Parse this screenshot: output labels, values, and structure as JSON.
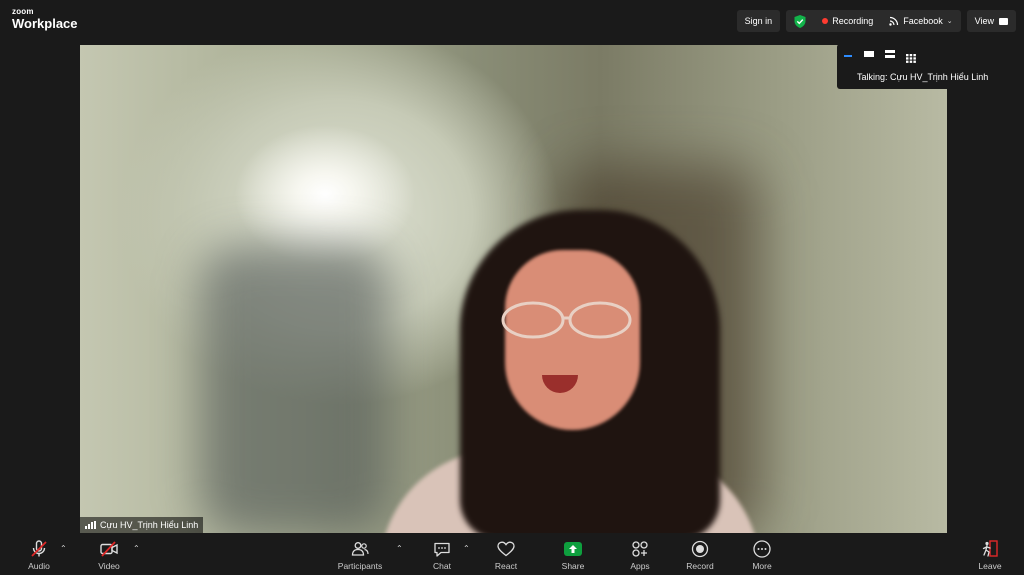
{
  "app": {
    "logo_small": "zoom",
    "logo_big": "Workplace"
  },
  "topbar": {
    "sign_in": "Sign in",
    "recording": "Recording",
    "stream": "Facebook",
    "view": "View"
  },
  "video": {
    "participant_name": "Cựu HV_Trịnh Hiểu Linh"
  },
  "overlay": {
    "talking": "Talking: Cựu HV_Trịnh Hiểu Linh"
  },
  "toolbar": {
    "audio": "Audio",
    "video": "Video",
    "participants": "Participants",
    "chat": "Chat",
    "react": "React",
    "share": "Share",
    "apps": "Apps",
    "record": "Record",
    "more": "More",
    "leave": "Leave"
  },
  "colors": {
    "accent_green": "#0e9f3e",
    "recording_red": "#ff3b30",
    "muted_red": "#e02828"
  }
}
